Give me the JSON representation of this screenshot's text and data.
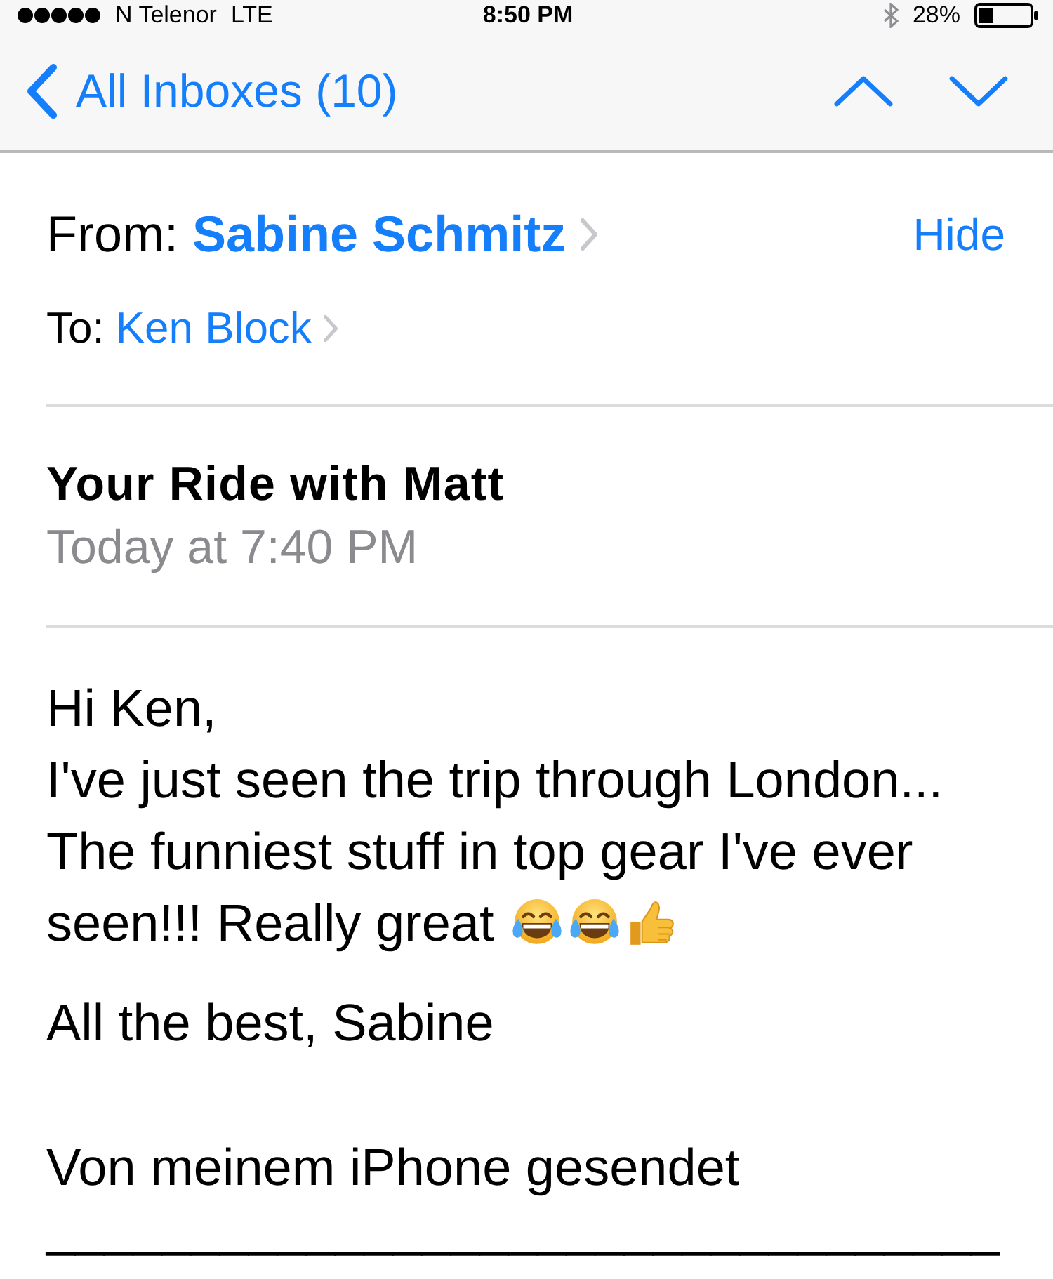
{
  "status_bar": {
    "carrier": "N Telenor",
    "network": "LTE",
    "time": "8:50 PM",
    "battery": "28%"
  },
  "nav": {
    "back_label": "All Inboxes (10)"
  },
  "header": {
    "from_label": "From:",
    "from_name": "Sabine Schmitz",
    "hide": "Hide",
    "to_label": "To:",
    "to_name": "Ken Block"
  },
  "message": {
    "subject": "Your Ride with Matt",
    "date": "Today at 7:40 PM"
  },
  "body": {
    "lines": [
      {
        "text": "Hi Ken,"
      },
      {
        "text": "I've just seen the trip through London..."
      },
      {
        "text": "The funniest stuff in top gear I've ever"
      },
      {
        "text": "seen!!! Really great",
        "emojis": [
          {
            "kind": "tears_of_joy"
          },
          {
            "kind": "tears_of_joy"
          },
          {
            "kind": "thumbs_up"
          }
        ]
      }
    ],
    "closing": "All the best, Sabine"
  },
  "signature": {
    "text": "Von meinem iPhone gesendet",
    "rule": "_________________________________"
  }
}
